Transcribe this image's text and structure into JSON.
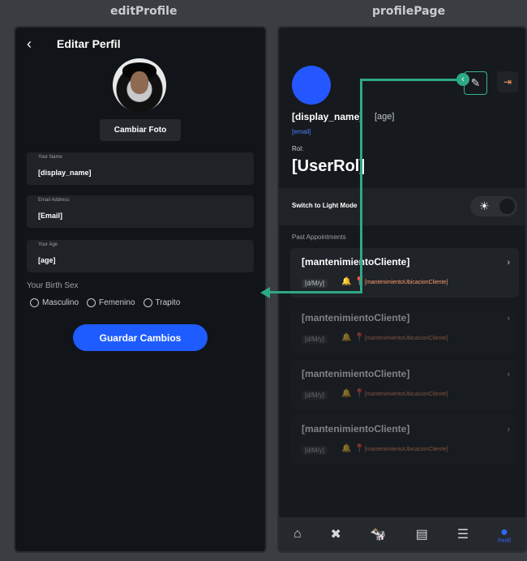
{
  "frames": {
    "left_title": "editProfile",
    "right_title": "profilePage"
  },
  "edit_profile": {
    "title": "Editar Perfil",
    "change_photo": "Cambiar Foto",
    "fields": [
      {
        "label": "Your Name",
        "value": "[display_name]"
      },
      {
        "label": "Email Address",
        "value": "[Email]"
      },
      {
        "label": "Your Age",
        "value": "[age]"
      }
    ],
    "birth_sex_label": "Your Birth Sex",
    "sex_options": [
      "Masculino",
      "Femenino",
      "Trapito"
    ],
    "save_button": "Guardar Cambios"
  },
  "profile": {
    "display_name": "[display_name]",
    "age": "[age]",
    "email": "[email]",
    "rol_label": "Rol:",
    "rol_value": "[UserRol]",
    "light_mode_label": "Switch to Light Mode",
    "past_appointments_title": "Past Appointments",
    "appointments": [
      {
        "title": "[mantenimientoCliente]",
        "date": "[d/M/y]",
        "location": "[mantenimientoUbicacionCliente]"
      },
      {
        "title": "[mantenimientoCliente]",
        "date": "[d/M/y]",
        "location": "[mantenimientoUbicacionCliente]"
      },
      {
        "title": "[mantenimientoCliente]",
        "date": "[d/M/y]",
        "location": "[mantenimientoUbicacionCliente]"
      },
      {
        "title": "[mantenimientoCliente]",
        "date": "[d/M/y]",
        "location": "[mantenimientoUbicacionCliente]"
      }
    ],
    "nav_active_label": "Perfil"
  },
  "icons": {
    "back": "chevron-left-icon",
    "edit": "pencil-icon",
    "logout": "logout-icon",
    "sun": "sun-icon",
    "bell": "bell-icon",
    "pin": "location-pin-icon",
    "nav": [
      "home-icon",
      "tools-icon",
      "cow-icon",
      "map-icon",
      "list-icon",
      "user-icon"
    ]
  },
  "colors": {
    "accent_blue": "#2457ff",
    "connector_green": "#2ea987",
    "location_orange": "#ff9d6b",
    "background": "#111418"
  }
}
